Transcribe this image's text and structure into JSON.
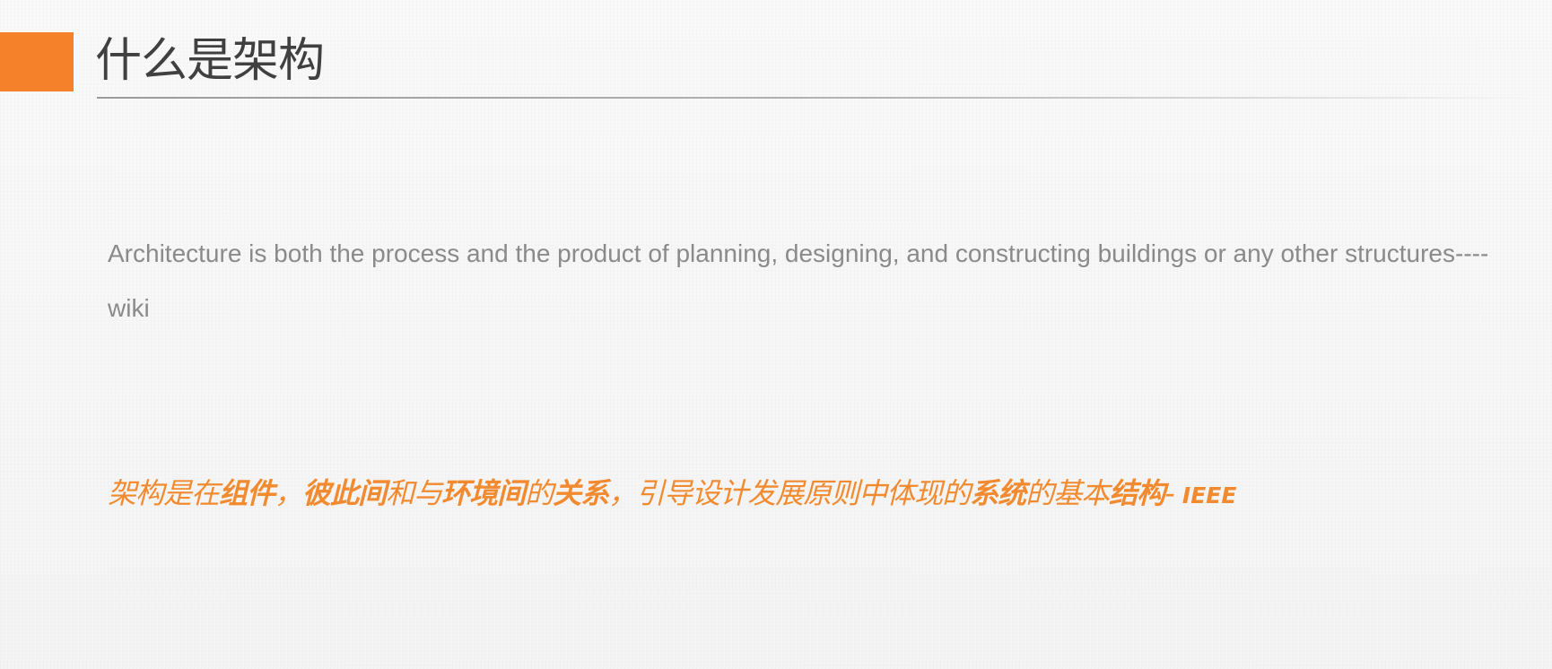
{
  "colors": {
    "accent": "#F5822A",
    "title_text": "#404040",
    "body_text": "#8A8A8A",
    "highlight_text": "#F28A2F"
  },
  "slide": {
    "title": "什么是架构"
  },
  "quote_en": {
    "text": "Architecture is both the process and the product of planning, designing, and constructing buildings or any other structures----wiki"
  },
  "quote_cn": {
    "segments": [
      {
        "text": "架构是在",
        "bold": false
      },
      {
        "text": "组件",
        "bold": true
      },
      {
        "text": "，",
        "bold": false
      },
      {
        "text": "彼此间",
        "bold": true
      },
      {
        "text": "和与",
        "bold": false
      },
      {
        "text": "环境间",
        "bold": true
      },
      {
        "text": "的",
        "bold": false
      },
      {
        "text": "关系",
        "bold": true
      },
      {
        "text": "，引导设计发展原则中体现的",
        "bold": false
      },
      {
        "text": "系统",
        "bold": true
      },
      {
        "text": "的基本",
        "bold": false
      },
      {
        "text": "结构",
        "bold": true
      },
      {
        "text": "- ",
        "bold": false
      },
      {
        "text": "IEEE",
        "bold": true
      }
    ]
  }
}
